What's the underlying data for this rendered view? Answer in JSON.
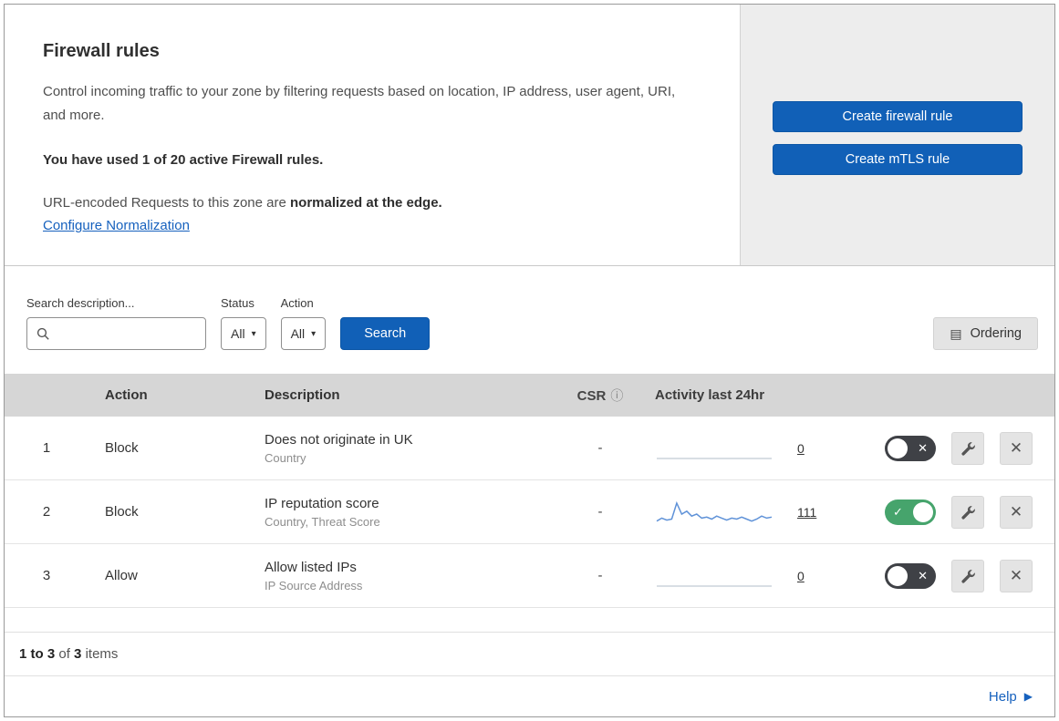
{
  "colors": {
    "primary_blue": "#1160b7",
    "link_blue": "#1661be",
    "toggle_on_green": "#46a46c",
    "toggle_off_dark": "#3f4146",
    "sparkline_blue": "#5f92d8",
    "table_header_gray": "#d6d6d6"
  },
  "icons": {
    "caret": "▾",
    "info": "ⓘ",
    "check": "✓",
    "cross": "✕",
    "help_arrow": "▶",
    "ordering": "▤"
  },
  "header": {
    "title": "Firewall rules",
    "description": "Control incoming traffic to your zone by filtering requests based on location, IP address, user agent, URI, and more.",
    "usage": "You have used 1 of 20 active Firewall rules.",
    "normalization_prefix": "URL-encoded Requests to this zone are ",
    "normalization_bold": "normalized at the edge.",
    "configure_link": "Configure Normalization",
    "buttons": {
      "create_firewall": "Create firewall rule",
      "create_mtls": "Create mTLS rule"
    }
  },
  "filters": {
    "search_label": "Search description...",
    "status_label": "Status",
    "status_value": "All",
    "action_label": "Action",
    "action_value": "All",
    "search_button": "Search",
    "ordering_button": "Ordering"
  },
  "table": {
    "columns": {
      "action": "Action",
      "description": "Description",
      "csr": "CSR",
      "activity": "Activity last 24hr"
    },
    "rows": [
      {
        "num": "1",
        "action": "Block",
        "description": "Does not originate in UK",
        "criteria": "Country",
        "csr": "-",
        "activity_count": "0",
        "enabled": false,
        "sparkline": [
          0,
          0,
          0,
          0,
          0,
          0,
          0,
          0,
          0,
          0,
          0,
          0,
          0,
          0,
          0,
          0,
          0,
          0,
          0,
          0,
          0,
          0,
          0,
          0
        ]
      },
      {
        "num": "2",
        "action": "Block",
        "description": "IP reputation score",
        "criteria": "Country, Threat Score",
        "csr": "-",
        "activity_count": "111",
        "enabled": true,
        "sparkline": [
          3,
          6,
          4,
          5,
          21,
          10,
          13,
          8,
          10,
          6,
          7,
          5,
          8,
          6,
          4,
          6,
          5,
          7,
          5,
          3,
          5,
          8,
          6,
          7
        ]
      },
      {
        "num": "3",
        "action": "Allow",
        "description": "Allow listed IPs",
        "criteria": "IP Source Address",
        "csr": "-",
        "activity_count": "0",
        "enabled": false,
        "sparkline": [
          0,
          0,
          0,
          0,
          0,
          0,
          0,
          0,
          0,
          0,
          0,
          0,
          0,
          0,
          0,
          0,
          0,
          0,
          0,
          0,
          0,
          0,
          0,
          0
        ]
      }
    ]
  },
  "footer": {
    "range": "1 to 3",
    "of": "of",
    "total": "3",
    "items": "items"
  },
  "help": {
    "label": "Help"
  }
}
